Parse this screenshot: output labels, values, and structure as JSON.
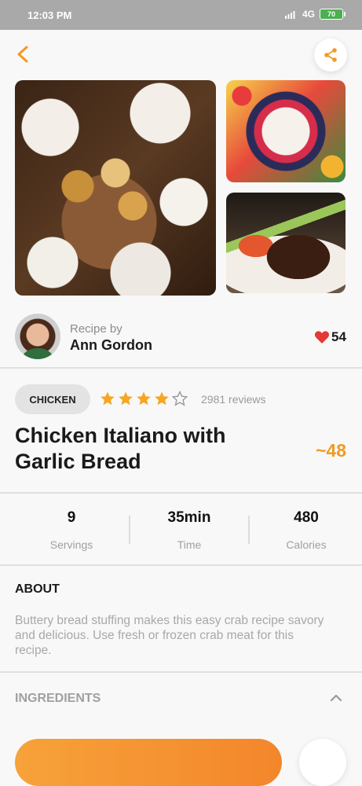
{
  "status_bar": {
    "time": "12:03 PM",
    "network": "4G",
    "battery": "70"
  },
  "header": {
    "back_icon": "chevron-left-icon",
    "share_icon": "share-icon"
  },
  "author": {
    "label": "Recipe by",
    "name": "Ann Gordon",
    "likes": "54"
  },
  "recipe": {
    "tag": "CHICKEN",
    "rating": 4,
    "rating_max": 5,
    "reviews": "2981 reviews",
    "title": "Chicken Italiano with Garlic Bread",
    "score": "~48"
  },
  "stats": [
    {
      "value": "9",
      "label": "Servings"
    },
    {
      "value": "35min",
      "label": "Time"
    },
    {
      "value": "480",
      "label": "Calories"
    }
  ],
  "about": {
    "heading": "ABOUT",
    "text": "Buttery bread stuffing makes this easy crab recipe savory and delicious. Use fresh or frozen crab meat for this recipe."
  },
  "ingredients": {
    "heading": "INGREDIENTS",
    "toggle_icon": "chevron-up-icon"
  },
  "colors": {
    "accent": "#f29a22",
    "heart": "#e53935",
    "star": "#f5a623"
  }
}
